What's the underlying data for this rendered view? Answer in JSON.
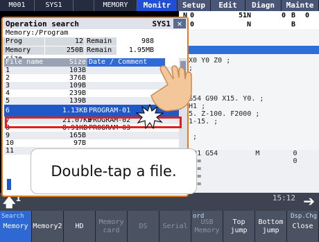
{
  "topbar": {
    "cells": [
      "M001",
      "SYS1",
      "",
      "MEMORY"
    ],
    "tabs": [
      "Monitr",
      "Setup",
      "Edit",
      "Diagn",
      "Mainte"
    ],
    "active_tab": "Monitr"
  },
  "background": {
    "coord_lines": [
      [
        "N",
        "0",
        "51",
        "N",
        "0",
        "B",
        "0"
      ],
      [
        "",
        "0",
        "",
        "N",
        "",
        "B",
        ""
      ]
    ],
    "program_lines": [
      "3 X0 Y0 Z0 ;",
      "1 ;",
      "",
      "0 ;",
      "",
      "  G54 G90 X15. Y0. ;",
      "  H1 ;",
      "  5. Z-100. F2000 ;",
      "2 1-15. ;",
      "1;",
      "5. ;"
    ],
    "mode_lines": [
      "  G91 G54         M        0",
      "    =                      0",
      "  ar=",
      "    =",
      "  ar="
    ]
  },
  "dialog": {
    "title": "Operation search",
    "system": "SYS1",
    "close_label": "✕",
    "memory_label": "Memory:/Program",
    "stats": [
      {
        "key": "Prog entry",
        "value": "12",
        "key2": "Remain",
        "value2": "988"
      },
      {
        "key": "Memory size",
        "value": "250B",
        "key2": "Remain",
        "value2": "1.95MB"
      }
    ],
    "columns": [
      "File name",
      "Size",
      "Date / Comment"
    ],
    "rows": [
      {
        "name": "1",
        "size": "103B",
        "comment": ""
      },
      {
        "name": "2",
        "size": "376B",
        "comment": ""
      },
      {
        "name": "3",
        "size": "109B",
        "comment": ""
      },
      {
        "name": "4",
        "size": "239B",
        "comment": ""
      },
      {
        "name": "5",
        "size": "139B",
        "comment": ""
      },
      {
        "name": "6",
        "size": "1.13KB",
        "comment": "PROGRAM-01",
        "selected": true
      },
      {
        "name": "7",
        "size": "21.07KB",
        "comment": "PROGRAM-02"
      },
      {
        "name": "8",
        "size": "8.91KB",
        "comment": "PROGRAM-03"
      },
      {
        "name": "9",
        "size": "165B",
        "comment": ""
      },
      {
        "name": "10",
        "size": "97B",
        "comment": ""
      },
      {
        "name": "11",
        "size": "",
        "comment": ""
      }
    ]
  },
  "callout": {
    "text": "Double-tap a file."
  },
  "status": {
    "time": "15:12",
    "left_digit": "1"
  },
  "softkeys": [
    {
      "label": "Memory",
      "header": "Search",
      "active": true
    },
    {
      "label": "Memory2",
      "header": ""
    },
    {
      "label": "HD",
      "header": ""
    },
    {
      "label": "Memory\ncard",
      "header": "",
      "disabled": true
    },
    {
      "label": "DS",
      "header": "",
      "disabled": true
    },
    {
      "label": "Serial",
      "header": "",
      "disabled": true
    },
    {
      "label": "USB\nMemory",
      "header": "ord",
      "disabled": true
    },
    {
      "label": "Top\njump",
      "header": ""
    },
    {
      "label": "Bottom\njump",
      "header": ""
    },
    {
      "label": "Close",
      "header": "Dsp.Chg",
      "header_right": true
    }
  ],
  "colors": {
    "accent": "#2f6bd6",
    "dialog_border": "#e47a1e",
    "highlight": "#e02020",
    "active_tab": "#1f4fd6"
  }
}
